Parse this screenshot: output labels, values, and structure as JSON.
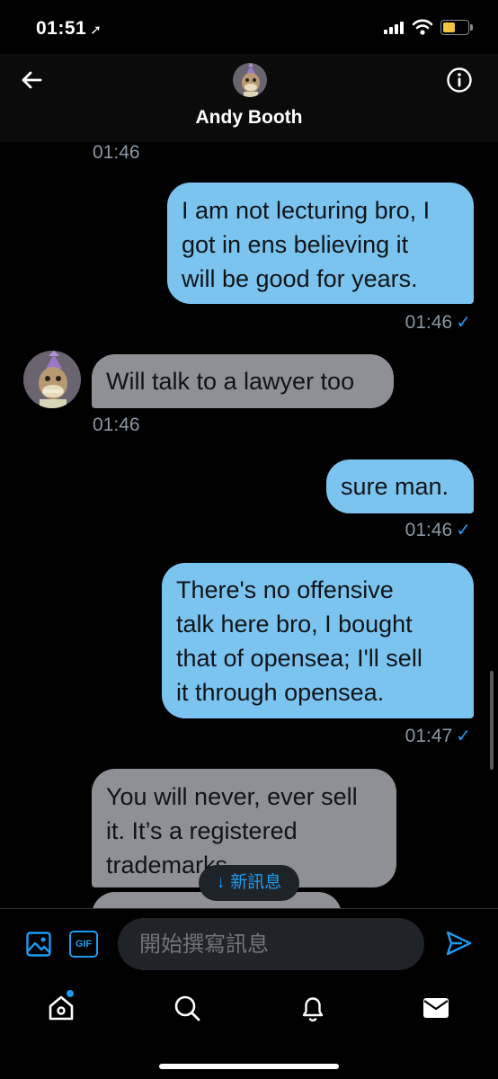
{
  "status_bar": {
    "time": "01:51",
    "location_glyph": "➚",
    "battery_color": "#f5c342"
  },
  "header": {
    "name": "Andy Booth",
    "back_icon": "arrow-left-icon",
    "info_icon": "info-icon"
  },
  "messages": {
    "t1": "01:46",
    "out1_lines": [
      "I am not lecturing bro, I",
      "got in ens believing it",
      "will be good for years."
    ],
    "t2": "01:46",
    "in1": "Will talk to a lawyer too",
    "t3": "01:46",
    "out2": "sure man.",
    "t4": "01:46",
    "out3_lines": [
      "There's no offensive",
      "talk here bro, I bought",
      "that of opensea; I'll sell",
      "it through opensea."
    ],
    "t5": "01:47",
    "in2_lines": [
      "You will never, ever sell",
      "it. It’s a registered",
      "trademarks."
    ],
    "check": "✓"
  },
  "new_messages_pill": {
    "arrow": "↓",
    "label": "新訊息"
  },
  "composer": {
    "placeholder": "開始撰寫訊息",
    "gif_label": "GIF"
  },
  "colors": {
    "accent": "#1d9bf0",
    "outgoing_bubble": "#7cc4f0",
    "incoming_bubble": "#8e9096",
    "background": "#000000"
  }
}
